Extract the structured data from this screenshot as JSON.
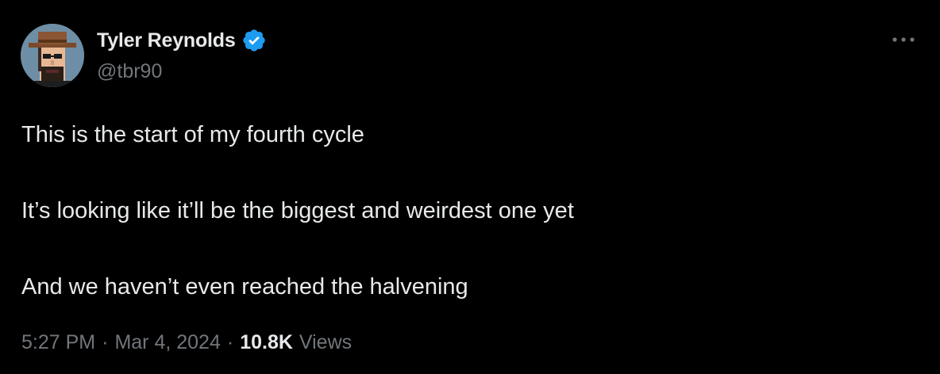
{
  "author": {
    "display_name": "Tyler Reynolds",
    "handle": "@tbr90",
    "verified": true,
    "avatar_icon": "pixel-cowboy-avatar",
    "verified_color": "#1d9bf0"
  },
  "menu": {
    "more_icon": "more-horizontal-icon"
  },
  "tweet": {
    "lines": [
      "This is the start of my fourth cycle",
      "",
      "It’s looking like it’ll be the biggest and weirdest one yet",
      "",
      "And we haven’t even reached the halvening"
    ]
  },
  "meta": {
    "time": "5:27 PM",
    "separator": "·",
    "date": "Mar 4, 2024",
    "views_count": "10.8K",
    "views_label": "Views"
  },
  "colors": {
    "background": "#000000",
    "primary_text": "#e7e9ea",
    "secondary_text": "#71767b",
    "accent": "#1d9bf0"
  }
}
